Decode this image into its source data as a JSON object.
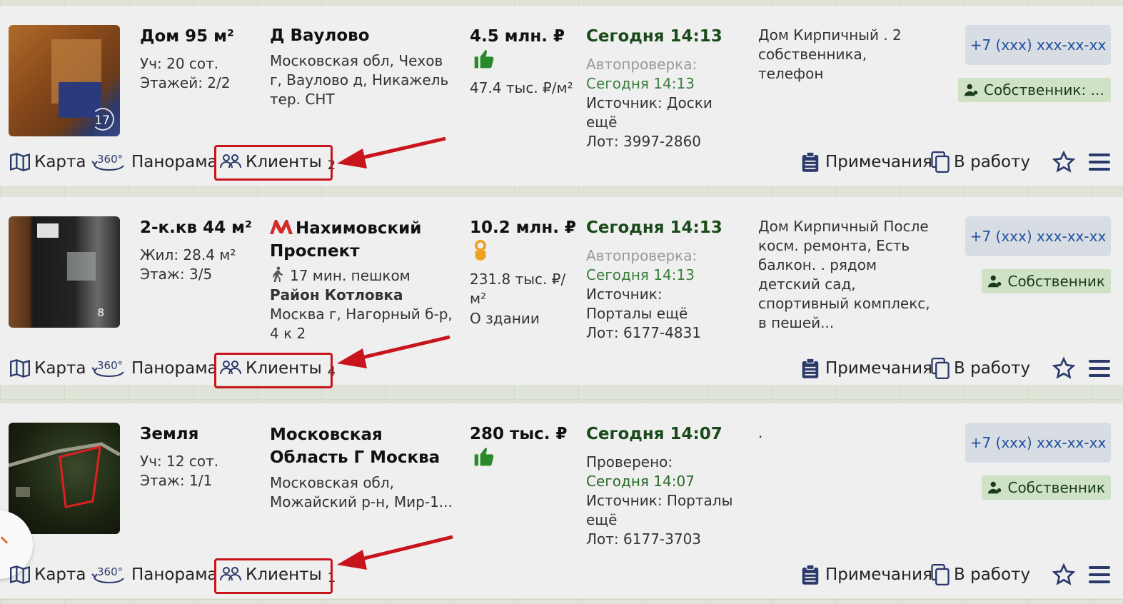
{
  "listings": [
    {
      "photo_count": "17",
      "title": "Дом 95 м²",
      "sub1": "Уч: 20 сот.",
      "sub2": "Этажей: 2/2",
      "location_title": "Д Ваулово",
      "address": "Московская обл, Чехов г, Ваулово д, Никажель тер. СНТ",
      "price": "4.5 млн. ₽",
      "price_rating_icon": "thumbs-up-icon",
      "price_per_m2": "47.4 тыс. ₽/м²",
      "date": "Сегодня 14:13",
      "check_label": "Автопроверка:",
      "check_value": "Сегодня 14:13",
      "source": "Источник: Доски ещё",
      "lot": "Лот: 3997-2860",
      "description": "Дом Кирпичный . 2 собственника, телефон",
      "phone": "+7 (xxx) xxx-xx-xx",
      "owner": "Собственник: ...",
      "clients_label": "Клиенты",
      "clients_count": "2"
    },
    {
      "photo_count": "8",
      "title": "2-к.кв 44 м²",
      "sub1": "Жил: 28.4 м²",
      "sub2": "Этаж: 3/5",
      "metro_name_1": "Нахимовский",
      "metro_name_2": "Проспект",
      "walk": "17 мин. пешком",
      "district": "Район Котловка",
      "address": "Москва г, Нагорный б-р, 4 к 2",
      "price": "10.2 млн. ₽",
      "price_rating_icon": "ok-hand-icon",
      "price_per_m2": "231.8 тыс. ₽/ м²",
      "building_link": "О здании",
      "date": "Сегодня 14:13",
      "check_label": "Автопроверка:",
      "check_value": "Сегодня 14:13",
      "source": "Источник: Порталы ещё",
      "lot": "Лот: 6177-4831",
      "description": "Дом Кирпичный После косм. ремонта, Есть балкон. . рядом детский сад, спортивный комплекс, в пешей...",
      "phone": "+7 (xxx) xxx-xx-xx",
      "owner": "Собственник",
      "clients_label": "Клиенты",
      "clients_count": "4"
    },
    {
      "title": "Земля",
      "sub1": "Уч: 12 сот.",
      "sub2": "Этаж: 1/1",
      "location_title": "Московская Область Г Москва",
      "address": "Московская обл, Можайский р-н, Мир-1...",
      "price": "280 тыс. ₽",
      "price_rating_icon": "thumbs-up-icon",
      "date": "Сегодня 14:07",
      "check_label": "Проверено:",
      "check_value": "Сегодня 14:07",
      "source": "Источник: Порталы ещё",
      "lot": "Лот: 6177-3703",
      "description": ".",
      "phone": "+7 (xxx) xxx-xx-xx",
      "owner": "Собственник",
      "clients_label": "Клиенты",
      "clients_count": "1"
    }
  ],
  "actions": {
    "map": "Карта",
    "panorama": "Панорама",
    "panorama_badge": "360°",
    "notes": "Примечания",
    "to_work": "В работу"
  },
  "colors": {
    "highlight": "#c8151b",
    "price_good": "#2a8a2a",
    "price_ok": "#f0a020",
    "phone": "#2050a0"
  }
}
